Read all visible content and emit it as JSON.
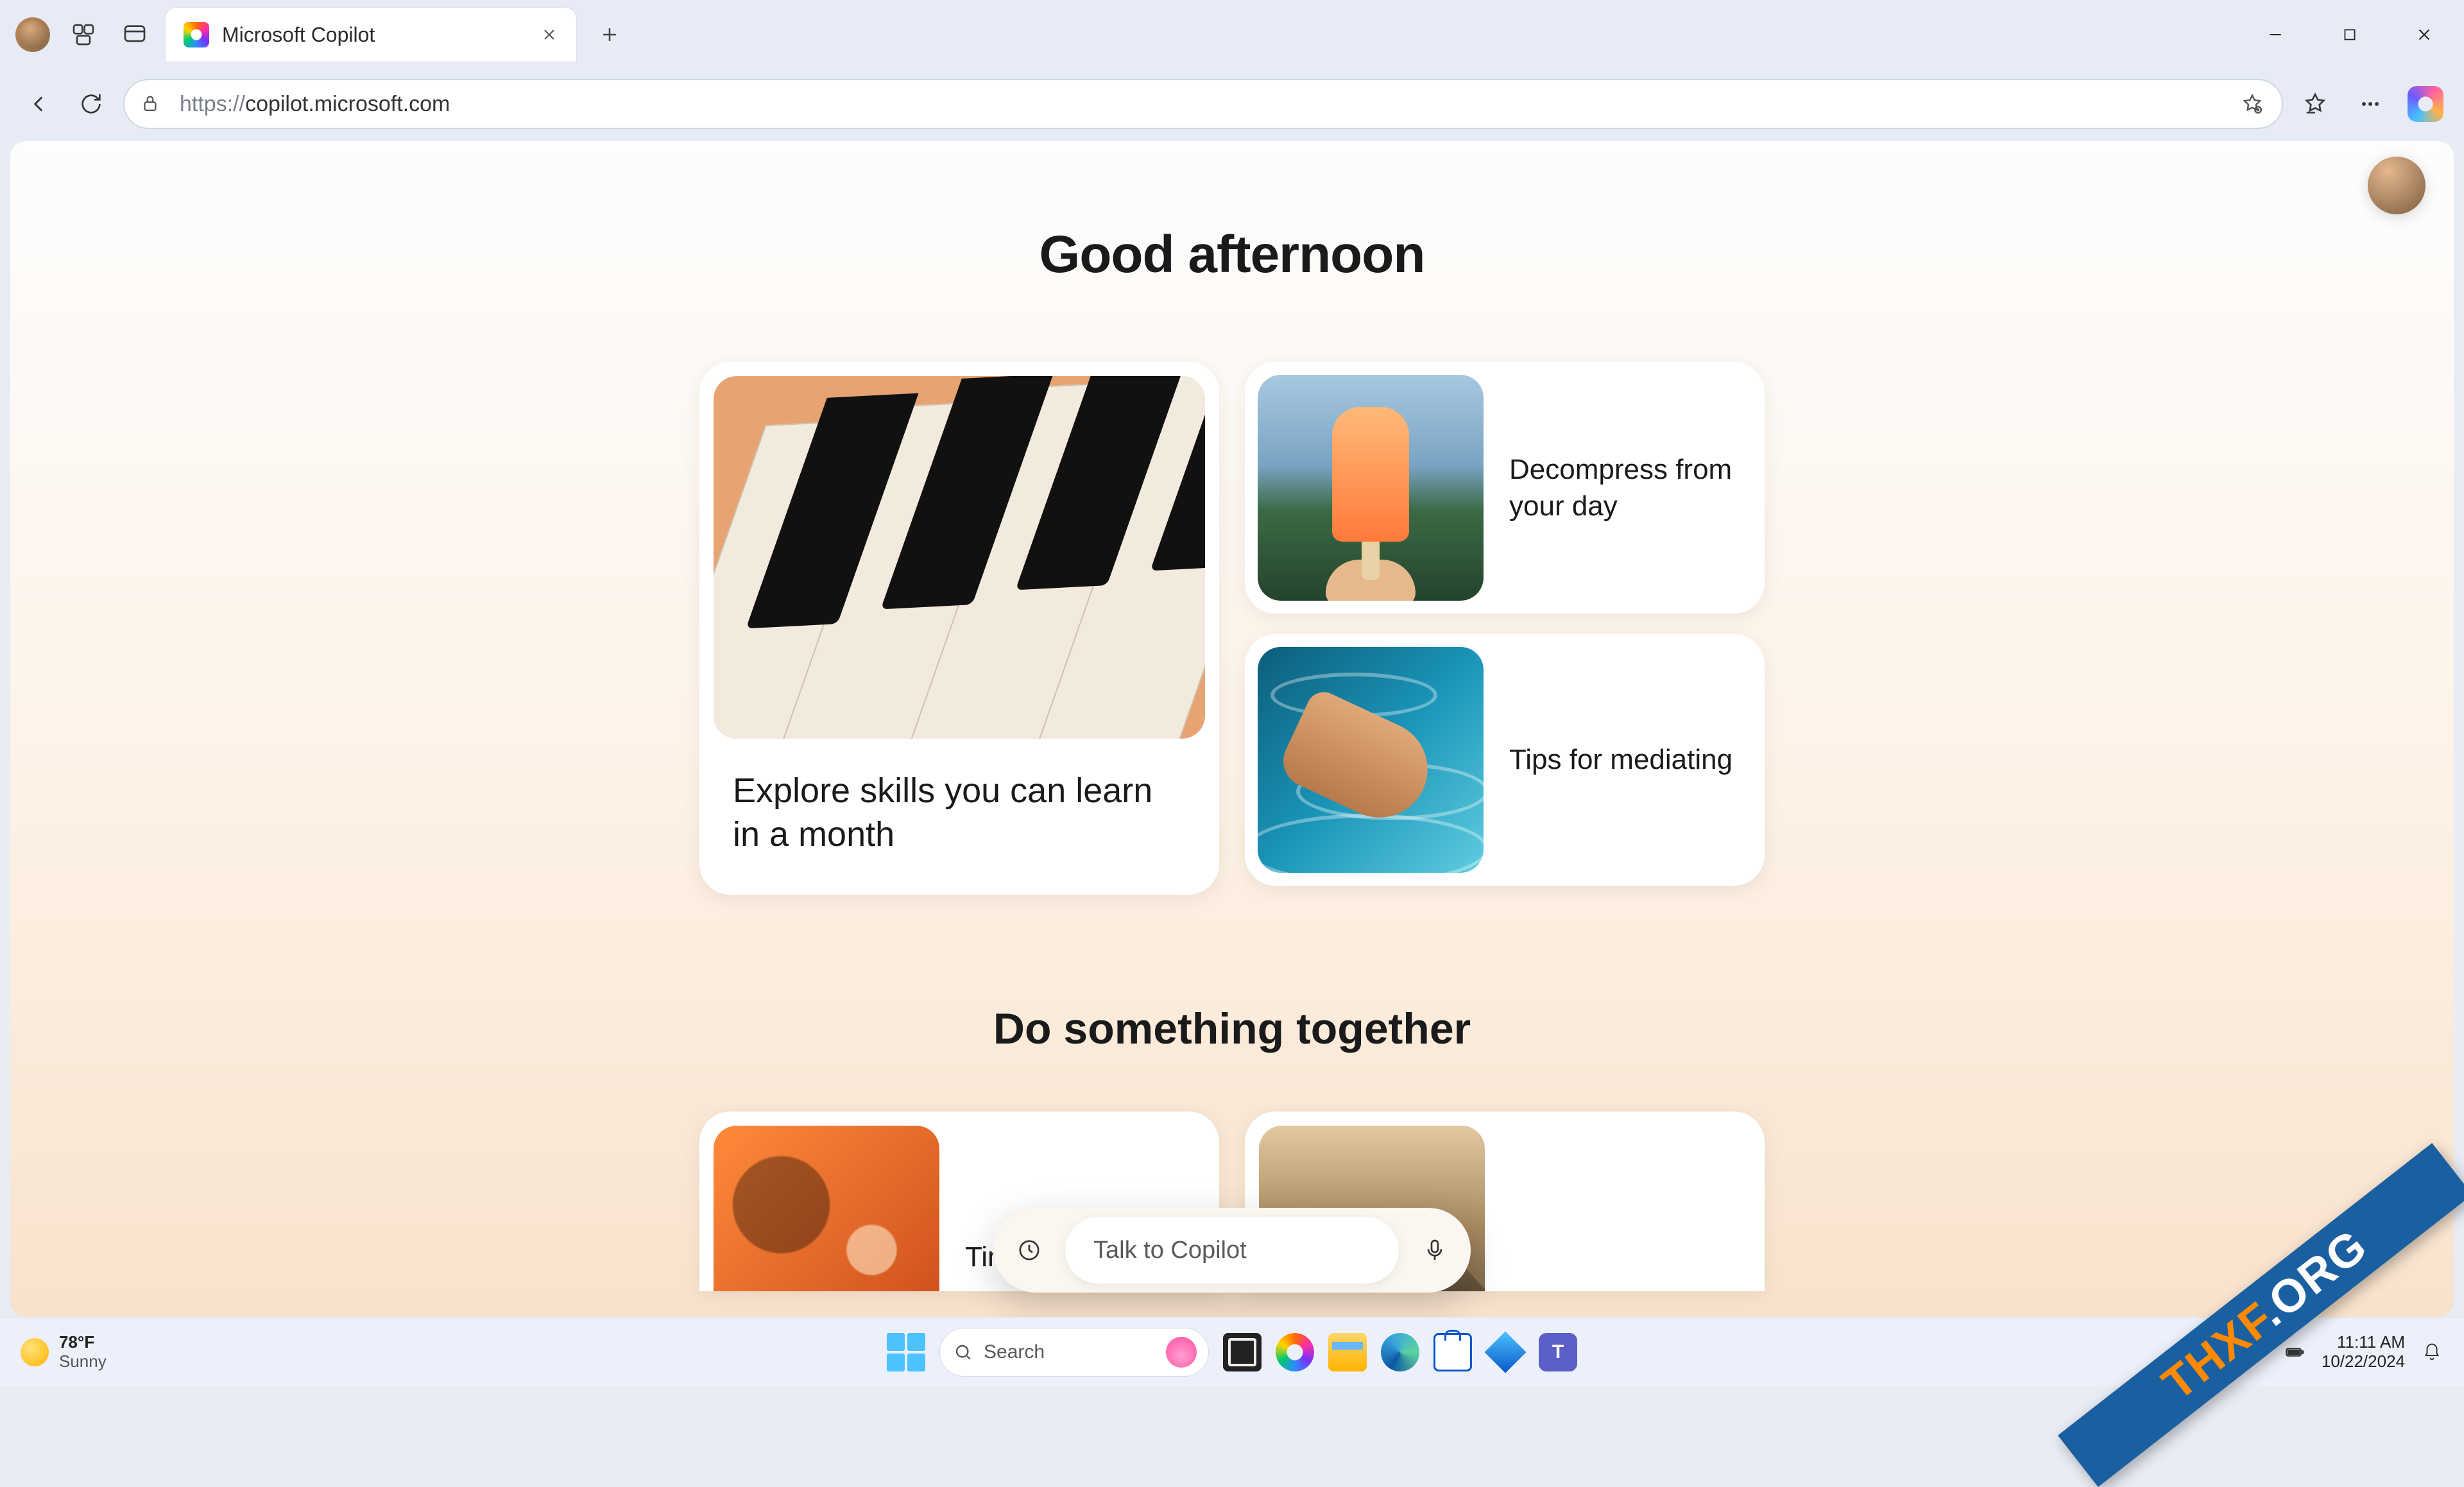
{
  "browser": {
    "tab_title": "Microsoft Copilot",
    "url_protocol": "https://",
    "url_rest": "copilot.microsoft.com",
    "new_tab_aria": "New tab"
  },
  "window_controls": {
    "minimize": "Minimize",
    "maximize": "Maximize",
    "close": "Close"
  },
  "page": {
    "greeting": "Good afternoon",
    "cards": {
      "learn": "Explore skills you can learn in a month",
      "decompress": "Decompress from your day",
      "mediating": "Tips for mediating"
    },
    "section2": "Do something together",
    "partial_card_a": "Tim",
    "chat_placeholder": "Talk to Copilot"
  },
  "taskbar": {
    "weather_temp": "78°F",
    "weather_cond": "Sunny",
    "search_placeholder": "Search",
    "time": "11:11 AM",
    "date": "10/22/2024"
  },
  "watermark": {
    "brand": "THXF",
    "suffix": ".ORG"
  }
}
